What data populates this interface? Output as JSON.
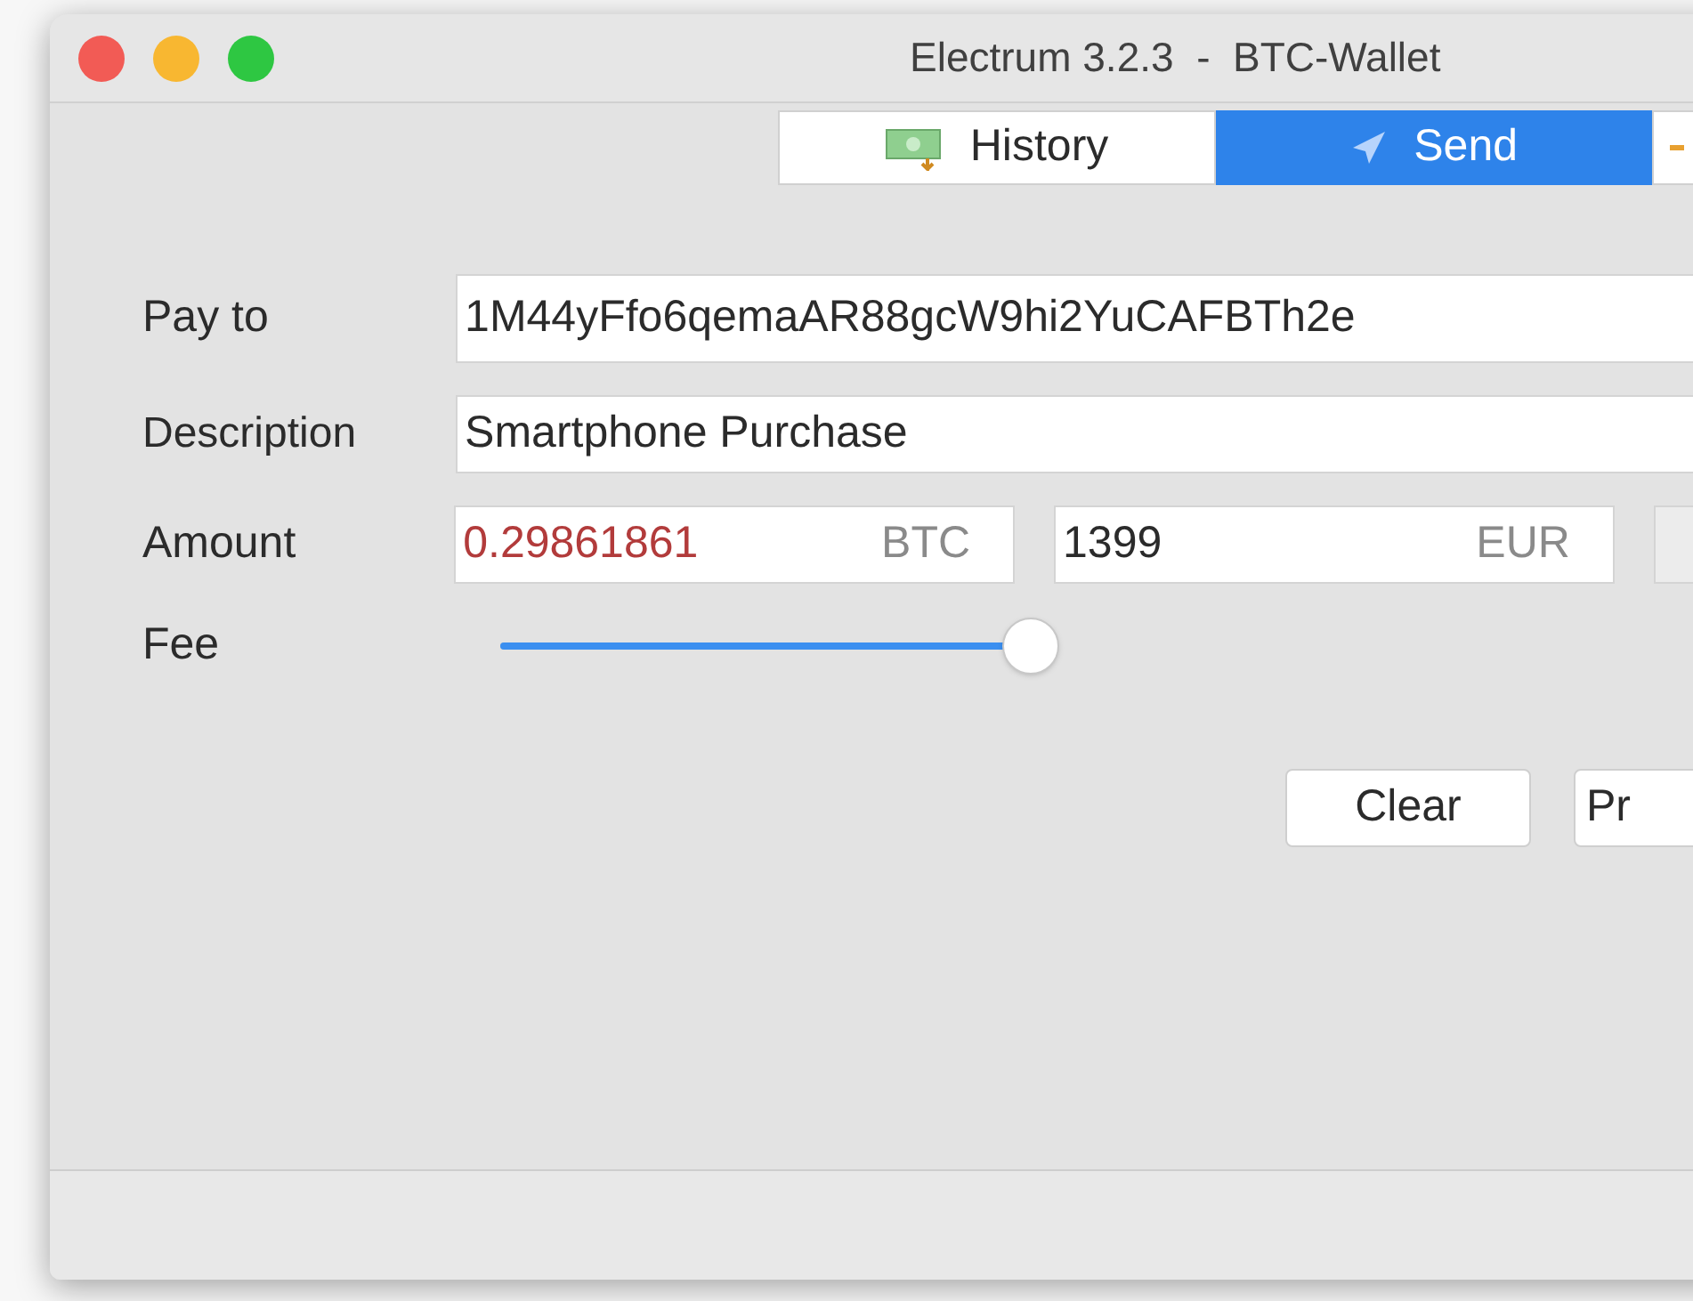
{
  "window": {
    "title": "Electrum 3.2.3  -  BTC-Wallet"
  },
  "tabs": [
    {
      "label": "History",
      "selected": false
    },
    {
      "label": "Send",
      "selected": true
    }
  ],
  "form": {
    "pay_to": {
      "label": "Pay to",
      "value": "1M44yFfo6qemaAR88gcW9hi2YuCAFBTh2e"
    },
    "description": {
      "label": "Description",
      "value": "Smartphone Purchase"
    },
    "amount": {
      "label": "Amount",
      "btc_value": "0.29861861",
      "btc_unit": "BTC",
      "fiat_value": "1399",
      "fiat_unit": "EUR"
    },
    "fee": {
      "label": "Fee",
      "level": 1
    }
  },
  "buttons": [
    "Clear",
    "Pr"
  ]
}
